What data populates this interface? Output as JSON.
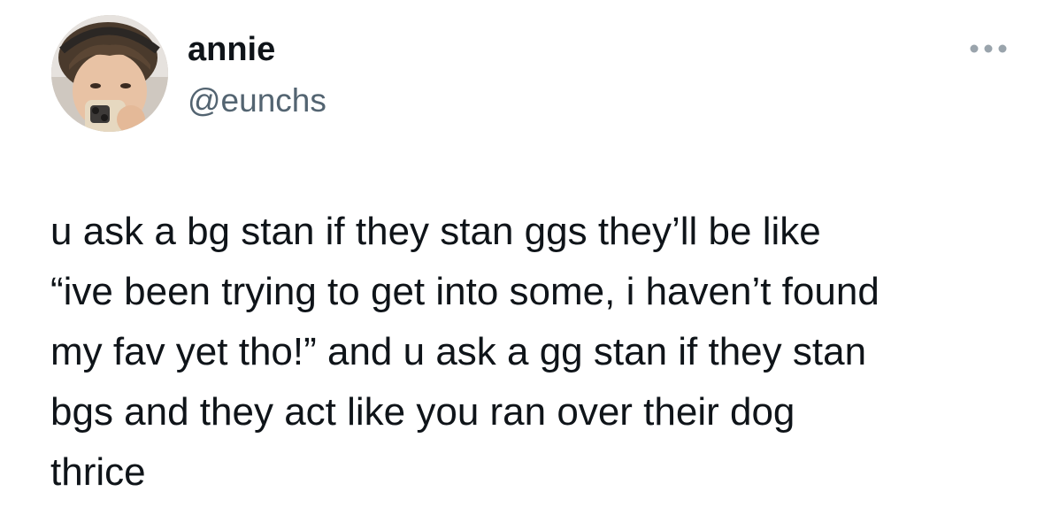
{
  "tweet": {
    "author": {
      "display_name": "annie",
      "handle": "@eunchs",
      "avatar_icon": "profile-photo-icon"
    },
    "more_icon": "more-options-icon",
    "text_lines": [
      "u ask a bg stan if they stan ggs they’ll be like",
      "“ive been trying to get into some, i haven’t found",
      "my fav yet tho!” and u ask a gg stan if they stan",
      "bgs and they act like you ran over their dog",
      "thrice"
    ]
  },
  "colors": {
    "background": "#ffffff",
    "text": "#0f1419",
    "secondary_text": "#536471",
    "icon_gray": "#9aa4ac"
  }
}
